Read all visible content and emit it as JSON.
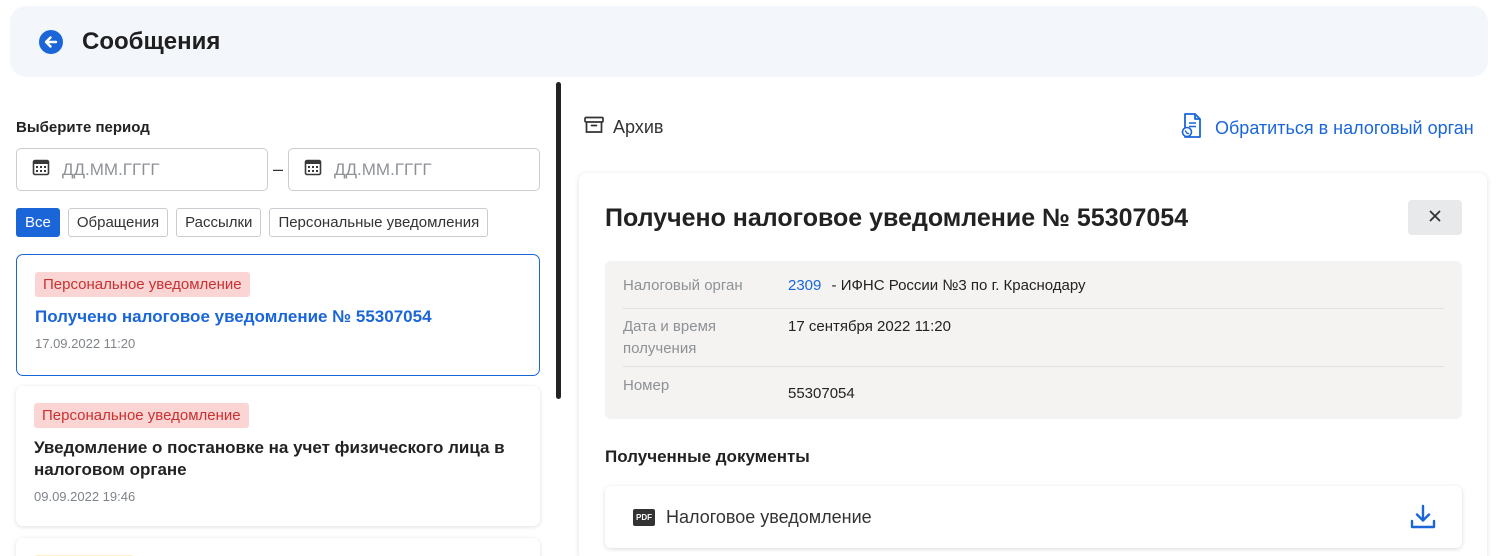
{
  "header": {
    "title": "Сообщения"
  },
  "filters": {
    "period_label": "Выберите период",
    "date_from_placeholder": "ДД.ММ.ГГГГ",
    "date_to_placeholder": "ДД.ММ.ГГГГ",
    "dash": "–",
    "chips": [
      {
        "label": "Все",
        "active": true
      },
      {
        "label": "Обращения",
        "active": false
      },
      {
        "label": "Рассылки",
        "active": false
      },
      {
        "label": "Персональные уведомления",
        "active": false
      }
    ]
  },
  "messages": [
    {
      "badge": "Персональное уведомление",
      "title": "Получено налоговое уведомление № 55307054",
      "date": "17.09.2022 11:20",
      "selected": true
    },
    {
      "badge": "Персональное уведомление",
      "title": "Уведомление о постановке на учет физического лица в налоговом органе",
      "date": "09.09.2022 19:46",
      "selected": false
    }
  ],
  "actions": {
    "archive_label": "Архив",
    "contact_label": "Обратиться в налоговый орган"
  },
  "detail": {
    "title": "Получено налоговое уведомление № 55307054",
    "rows": [
      {
        "label": "Налоговый орган",
        "code": "2309",
        "value": " - ИФНС России №3 по г. Краснодару"
      },
      {
        "label": "Дата и время получения",
        "value": "17 сентября 2022 11:20"
      },
      {
        "label": "Номер",
        "value": "55307054"
      }
    ],
    "documents_title": "Полученные документы",
    "documents": [
      {
        "icon": "pdf-icon",
        "icon_text": "PDF",
        "label": "Налоговое уведомление"
      }
    ]
  },
  "colors": {
    "accent": "#1a66d9",
    "badge_bg": "#fbd4d4",
    "badge_text": "#c93131",
    "header_bg": "#f3f6fb"
  }
}
